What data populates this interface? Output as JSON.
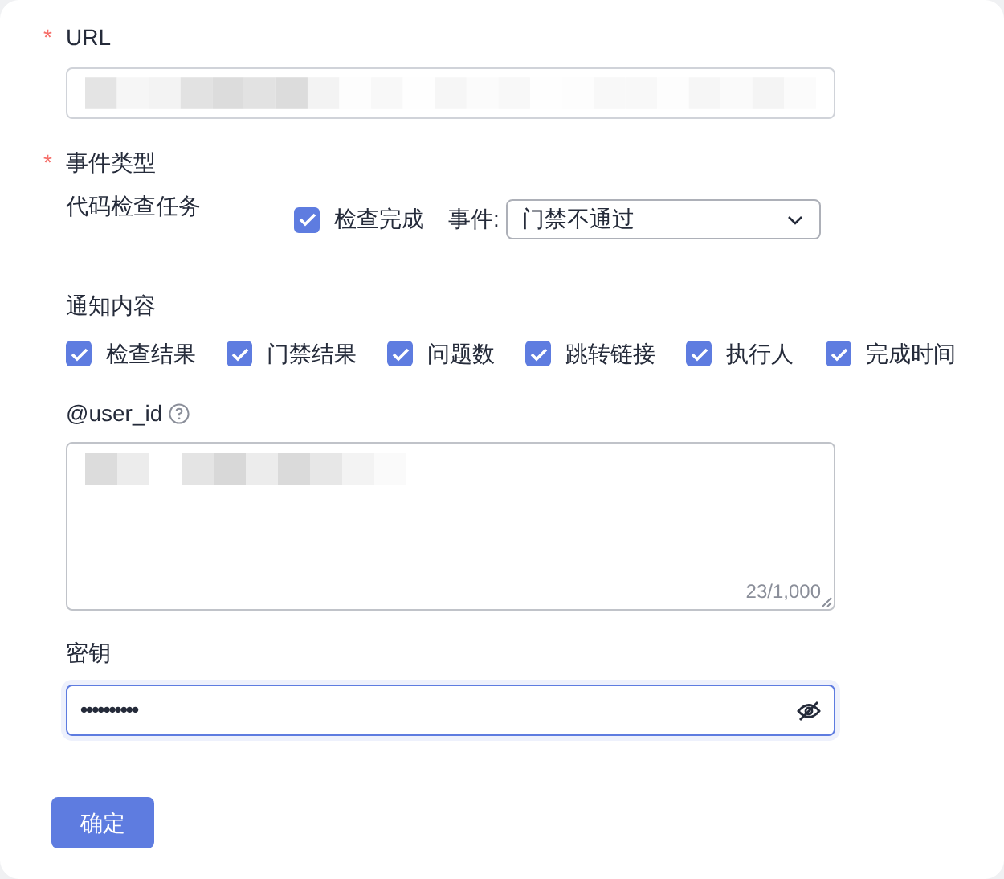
{
  "url": {
    "label": "URL",
    "required": true,
    "redacted": true
  },
  "event_type": {
    "label": "事件类型",
    "required": true,
    "task_label": "代码检查任务",
    "check": {
      "label": "检查完成",
      "checked": true
    },
    "event_label": "事件:",
    "event_value": "门禁不通过"
  },
  "notify": {
    "label": "通知内容",
    "options": [
      {
        "label": "检查结果",
        "checked": true
      },
      {
        "label": "门禁结果",
        "checked": true
      },
      {
        "label": "问题数",
        "checked": true
      },
      {
        "label": "跳转链接",
        "checked": true
      },
      {
        "label": "执行人",
        "checked": true
      },
      {
        "label": "完成时间",
        "checked": true
      }
    ]
  },
  "user_id": {
    "label": "@user_id",
    "redacted": true,
    "counter": "23/1,000"
  },
  "secret": {
    "label": "密钥",
    "value": "••••••••••",
    "focused": true
  },
  "submit": "确定",
  "required_mark": "*"
}
